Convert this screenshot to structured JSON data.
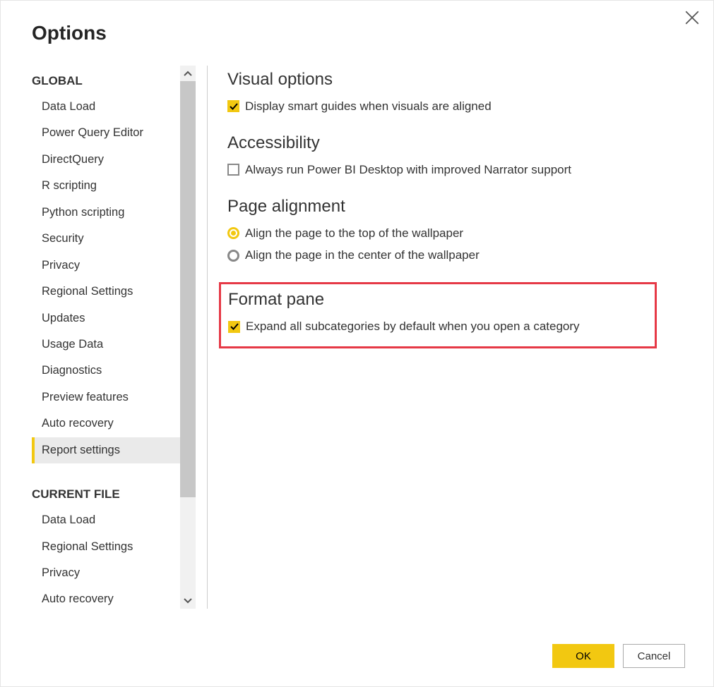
{
  "dialog": {
    "title": "Options"
  },
  "sidebar": {
    "sections": [
      {
        "header": "GLOBAL",
        "items": [
          {
            "label": "Data Load",
            "selected": false
          },
          {
            "label": "Power Query Editor",
            "selected": false
          },
          {
            "label": "DirectQuery",
            "selected": false
          },
          {
            "label": "R scripting",
            "selected": false
          },
          {
            "label": "Python scripting",
            "selected": false
          },
          {
            "label": "Security",
            "selected": false
          },
          {
            "label": "Privacy",
            "selected": false
          },
          {
            "label": "Regional Settings",
            "selected": false
          },
          {
            "label": "Updates",
            "selected": false
          },
          {
            "label": "Usage Data",
            "selected": false
          },
          {
            "label": "Diagnostics",
            "selected": false
          },
          {
            "label": "Preview features",
            "selected": false
          },
          {
            "label": "Auto recovery",
            "selected": false
          },
          {
            "label": "Report settings",
            "selected": true
          }
        ]
      },
      {
        "header": "CURRENT FILE",
        "items": [
          {
            "label": "Data Load",
            "selected": false
          },
          {
            "label": "Regional Settings",
            "selected": false
          },
          {
            "label": "Privacy",
            "selected": false
          },
          {
            "label": "Auto recovery",
            "selected": false
          }
        ]
      }
    ]
  },
  "content": {
    "groups": {
      "visual_options": {
        "title": "Visual options",
        "opt1": {
          "label": "Display smart guides when visuals are aligned",
          "checked": true
        }
      },
      "accessibility": {
        "title": "Accessibility",
        "opt1": {
          "label": "Always run Power BI Desktop with improved Narrator support",
          "checked": false
        }
      },
      "page_alignment": {
        "title": "Page alignment",
        "opt1": {
          "label": "Align the page to the top of the wallpaper",
          "selected": true
        },
        "opt2": {
          "label": "Align the page in the center of the wallpaper",
          "selected": false
        }
      },
      "format_pane": {
        "title": "Format pane",
        "opt1": {
          "label": "Expand all subcategories by default when you open a category",
          "checked": true
        }
      }
    }
  },
  "footer": {
    "ok": "OK",
    "cancel": "Cancel"
  }
}
